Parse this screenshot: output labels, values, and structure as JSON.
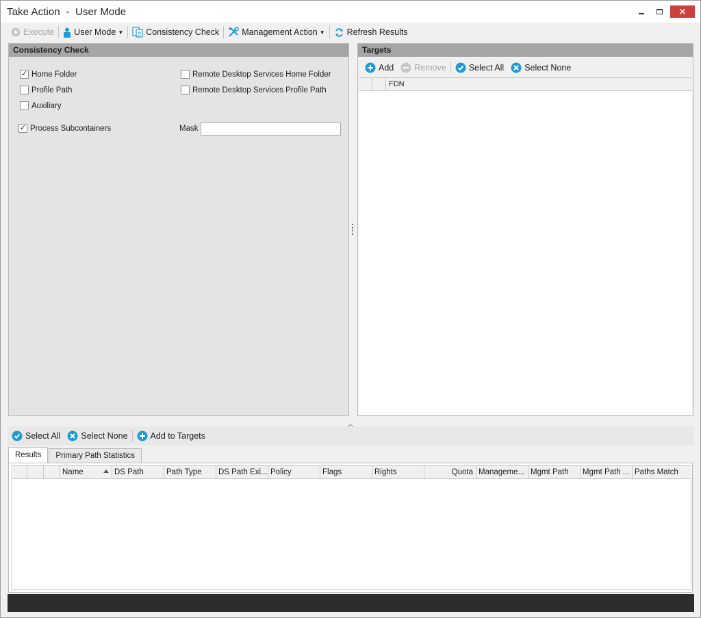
{
  "window": {
    "title": "Take Action  -  User Mode",
    "colors": {
      "close_button": "#c9403d",
      "panel_header": "#a5a5a5",
      "accent_icon": "#1e9ad6",
      "statusbar": "#2d2d2d"
    }
  },
  "toolbar": {
    "execute": "Execute",
    "user_mode": "User Mode",
    "consistency_check": "Consistency Check",
    "management_action": "Management Action",
    "refresh_results": "Refresh Results"
  },
  "consistency_panel": {
    "header": "Consistency Check",
    "options": {
      "home_folder": {
        "label": "Home Folder",
        "checked": true
      },
      "profile_path": {
        "label": "Profile Path",
        "checked": false
      },
      "auxiliary": {
        "label": "Auxiliary",
        "checked": false
      },
      "rds_home_folder": {
        "label": "Remote Desktop Services Home Folder",
        "checked": false
      },
      "rds_profile_path": {
        "label": "Remote Desktop Services Profile Path",
        "checked": false
      },
      "process_subcontainers": {
        "label": "Process Subcontainers",
        "checked": true
      }
    },
    "mask": {
      "label": "Mask",
      "value": ""
    }
  },
  "targets_panel": {
    "header": "Targets",
    "toolbar": {
      "add": "Add",
      "remove": "Remove",
      "select_all": "Select All",
      "select_none": "Select None"
    },
    "columns": [
      "FDN"
    ]
  },
  "results_toolbar": {
    "select_all": "Select All",
    "select_none": "Select None",
    "add_to_targets": "Add to Targets"
  },
  "tabs": [
    "Results",
    "Primary Path Statistics"
  ],
  "results_columns": [
    "Name",
    "DS Path",
    "Path Type",
    "DS Path Exi...",
    "Policy",
    "Flags",
    "Rights",
    "Quota",
    "Manageme...",
    "Mgmt Path",
    "Mgmt Path ...",
    "Paths Match"
  ]
}
